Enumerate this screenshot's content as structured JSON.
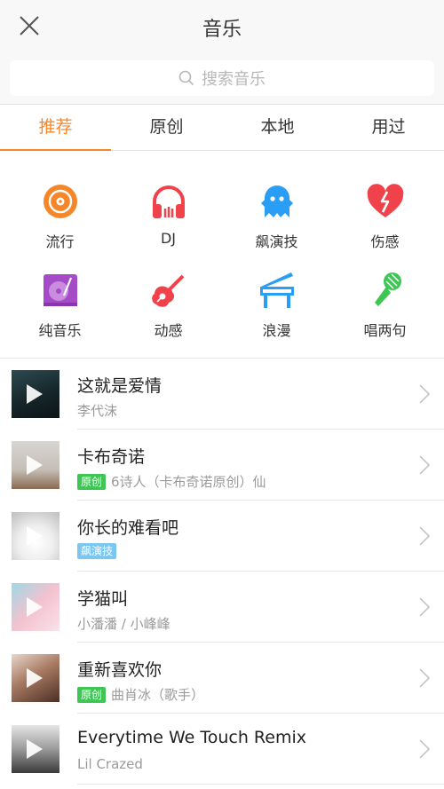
{
  "header": {
    "title": "音乐",
    "close_icon": "close-icon"
  },
  "search": {
    "placeholder": "搜索音乐",
    "icon": "search-icon"
  },
  "tabs": [
    {
      "label": "推荐",
      "active": true
    },
    {
      "label": "原创",
      "active": false
    },
    {
      "label": "本地",
      "active": false
    },
    {
      "label": "用过",
      "active": false
    }
  ],
  "genres": [
    {
      "label": "流行",
      "icon": "vinyl-icon",
      "color": "#f5872a"
    },
    {
      "label": "DJ",
      "icon": "headphones-icon",
      "color": "#f0424a"
    },
    {
      "label": "飙演技",
      "icon": "ghost-icon",
      "color": "#2a9df4"
    },
    {
      "label": "伤感",
      "icon": "broken-heart-icon",
      "color": "#f0424a"
    },
    {
      "label": "纯音乐",
      "icon": "record-player-icon",
      "color": "#a64bc8"
    },
    {
      "label": "动感",
      "icon": "guitar-icon",
      "color": "#f0424a"
    },
    {
      "label": "浪漫",
      "icon": "piano-icon",
      "color": "#2a9df4"
    },
    {
      "label": "唱两句",
      "icon": "microphone-icon",
      "color": "#3ec654"
    }
  ],
  "songs": [
    {
      "title": "这就是爱情",
      "artist": "李代沫",
      "badge": ""
    },
    {
      "title": "卡布奇诺",
      "artist": "6诗人（卡布奇诺原创）仙",
      "badge": "原创"
    },
    {
      "title": "你长的难看吧",
      "artist": "",
      "badge": "飙演技"
    },
    {
      "title": "学猫叫",
      "artist": "小潘潘 / 小峰峰",
      "badge": ""
    },
    {
      "title": "重新喜欢你",
      "artist": "曲肖冰（歌手）",
      "badge": "原创"
    },
    {
      "title": "Everytime We Touch Remix",
      "artist": "Lil Crazed",
      "badge": ""
    }
  ],
  "colors": {
    "accent": "#f5872a",
    "badge_original": "#3ec654",
    "badge_acting": "#7cc6f2"
  }
}
